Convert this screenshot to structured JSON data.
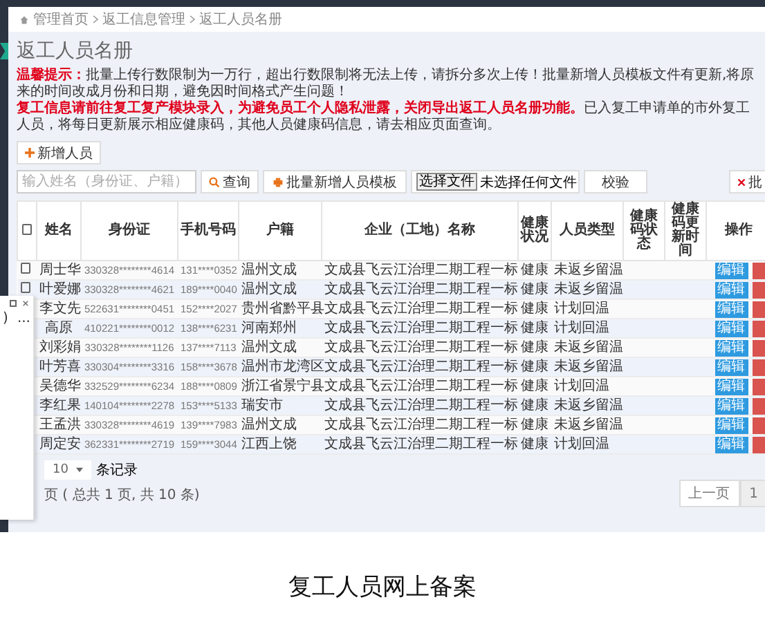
{
  "breadcrumb": [
    "管理首页",
    "返工信息管理",
    "返工人员名册"
  ],
  "page_title": "返工人员名册",
  "notice": {
    "label": "温馨提示：",
    "text": "批量上传行数限制为一万行，超出行数限制将无法上传，请拆分多次上传！批量新增人员模板文件有更新,将原来的时间改成月份和日期，避免因时间格式产生问题！"
  },
  "notice2": {
    "warning": "复工信息请前往复工复产模块录入，为避免员工个人隐私泄露，关闭导出返工人员名册功能。",
    "text": "已入复工申请单的市外复工人员，将每日更新展示相应健康码，其他人员健康码信息，请去相应页面查询。"
  },
  "add_button": "新增人员",
  "search": {
    "placeholder": "输入姓名（身份证、户籍）"
  },
  "query_button": "查询",
  "template_button": "批量新增人员模板",
  "file": {
    "button": "选择文件",
    "status": "未选择任何文件"
  },
  "verify_button": "校验",
  "batch_button": "批",
  "table": {
    "select_all": {
      "checked": false
    },
    "columns": [
      "姓名",
      "身份证",
      "手机号码",
      "户籍",
      "企业（工地）名称",
      "健康状况",
      "人员类型",
      "健康码状态",
      "健康码更新时间",
      "操作"
    ],
    "rows": [
      {
        "checked": false,
        "name": "周士华",
        "id": "330328********4614",
        "phone": "131****0352",
        "hukou": "温州文成",
        "company": "文成县飞云江治理二期工程一标",
        "health": "健康",
        "type": "未返乡留温",
        "edit": "编辑"
      },
      {
        "checked": false,
        "name": "叶爱娜",
        "id": "330328********4621",
        "phone": "189****0040",
        "hukou": "温州文成",
        "company": "文成县飞云江治理二期工程一标",
        "health": "健康",
        "type": "未返乡留温",
        "edit": "编辑"
      },
      {
        "name": "李文先",
        "id": "522631********0451",
        "phone": "152****2027",
        "hukou": "贵州省黔平县",
        "company": "文成县飞云江治理二期工程一标",
        "health": "健康",
        "type": "计划回温",
        "edit": "编辑"
      },
      {
        "name": "高原",
        "id": "410221********0012",
        "phone": "138****6231",
        "hukou": "河南郑州",
        "company": "文成县飞云江治理二期工程一标",
        "health": "健康",
        "type": "计划回温",
        "edit": "编辑"
      },
      {
        "name": "刘彩娟",
        "id": "330328********1126",
        "phone": "137****7113",
        "hukou": "温州文成",
        "company": "文成县飞云江治理二期工程一标",
        "health": "健康",
        "type": "未返乡留温",
        "edit": "编辑"
      },
      {
        "name": "叶芳喜",
        "id": "330304********3316",
        "phone": "158****3678",
        "hukou": "温州市龙湾区",
        "company": "文成县飞云江治理二期工程一标",
        "health": "健康",
        "type": "未返乡留温",
        "edit": "编辑"
      },
      {
        "name": "吴德华",
        "id": "332529********6234",
        "phone": "188****0809",
        "hukou": "浙江省景宁县",
        "company": "文成县飞云江治理二期工程一标",
        "health": "健康",
        "type": "计划回温",
        "edit": "编辑"
      },
      {
        "name": "李红果",
        "id": "140104********2278",
        "phone": "153****5133",
        "hukou": "瑞安市",
        "company": "文成县飞云江治理二期工程一标",
        "health": "健康",
        "type": "未返乡留温",
        "edit": "编辑"
      },
      {
        "name": "王孟洪",
        "id": "330328********4619",
        "phone": "139****7983",
        "hukou": "温州文成",
        "company": "文成县飞云江治理二期工程一标",
        "health": "健康",
        "type": "未返乡留温",
        "edit": "编辑"
      },
      {
        "name": "周定安",
        "id": "362331********2719",
        "phone": "159****3044",
        "hukou": "江西上饶",
        "company": "文成县飞云江治理二期工程一标",
        "health": "健康",
        "type": "计划回温",
        "edit": "编辑"
      }
    ]
  },
  "page_size": "10",
  "page_size_label": "条记录",
  "page_info": "页 ( 总共 1 页, 共 10 条)",
  "pager": [
    {
      "label": "上一页",
      "selected": false
    },
    {
      "label": "1",
      "selected": true
    }
  ],
  "popup": {
    "text": ")",
    "more": "..."
  },
  "caption": "复工人员网上备案"
}
